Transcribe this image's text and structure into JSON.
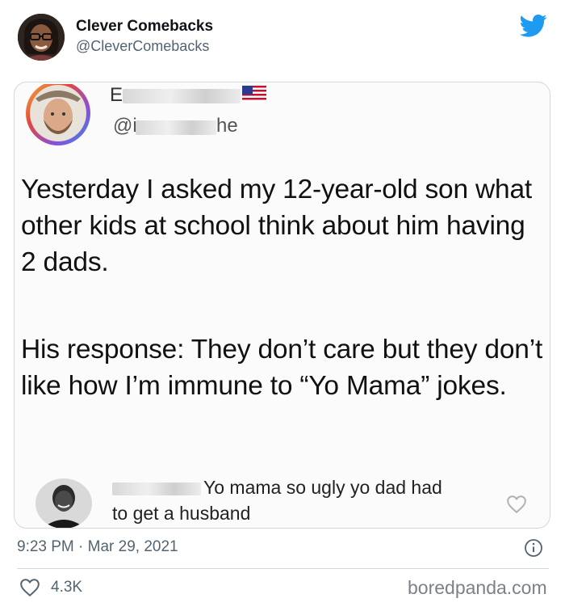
{
  "tweet": {
    "author_name": "Clever Comebacks",
    "author_handle": "@CleverComebacks",
    "timestamp": "9:23 PM · Mar 29, 2021",
    "likes": "4.3K",
    "brand_color": "#1d9bf0"
  },
  "embedded_post": {
    "name_visible_fragment": "E",
    "handle_visible_start": "@i",
    "handle_visible_end": "he",
    "paragraph_1": "Yesterday I asked my 12-year-old son what other kids at school think about him having 2 dads.",
    "paragraph_2": "His response: They don’t care but they don’t like how I’m immune to “Yo Mama” jokes.",
    "reply": {
      "line_1": "Yo mama so ugly yo dad had",
      "line_2": "to get a husband"
    }
  },
  "watermark": "boredpanda.com",
  "icons": [
    "twitter-bird-icon",
    "info-icon",
    "heart-icon",
    "flag-icon"
  ]
}
